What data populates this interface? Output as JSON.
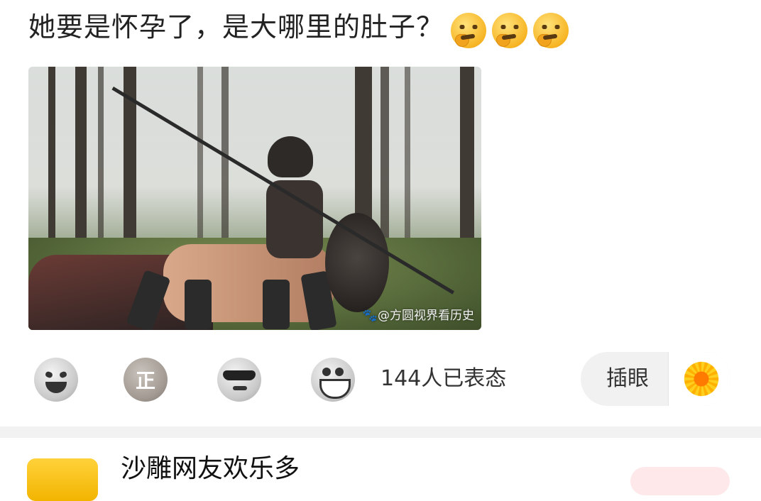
{
  "post": {
    "text": "她要是怀孕了，是大哪里的肚子？",
    "trailing_emojis": [
      "thinking-face",
      "thinking-face",
      "thinking-face"
    ]
  },
  "image": {
    "watermark": "🐾@方圆视界看历史"
  },
  "reactions": {
    "icons": [
      "laugh-cry-icon",
      "zheng-icon",
      "sunglasses-icon",
      "grin-icon"
    ],
    "zheng_label": "正",
    "count_text": "144人已表态",
    "poke_label": "插眼",
    "poke_icon": "sunflower-icon"
  },
  "next_card": {
    "title": "沙雕网友欢乐多"
  }
}
